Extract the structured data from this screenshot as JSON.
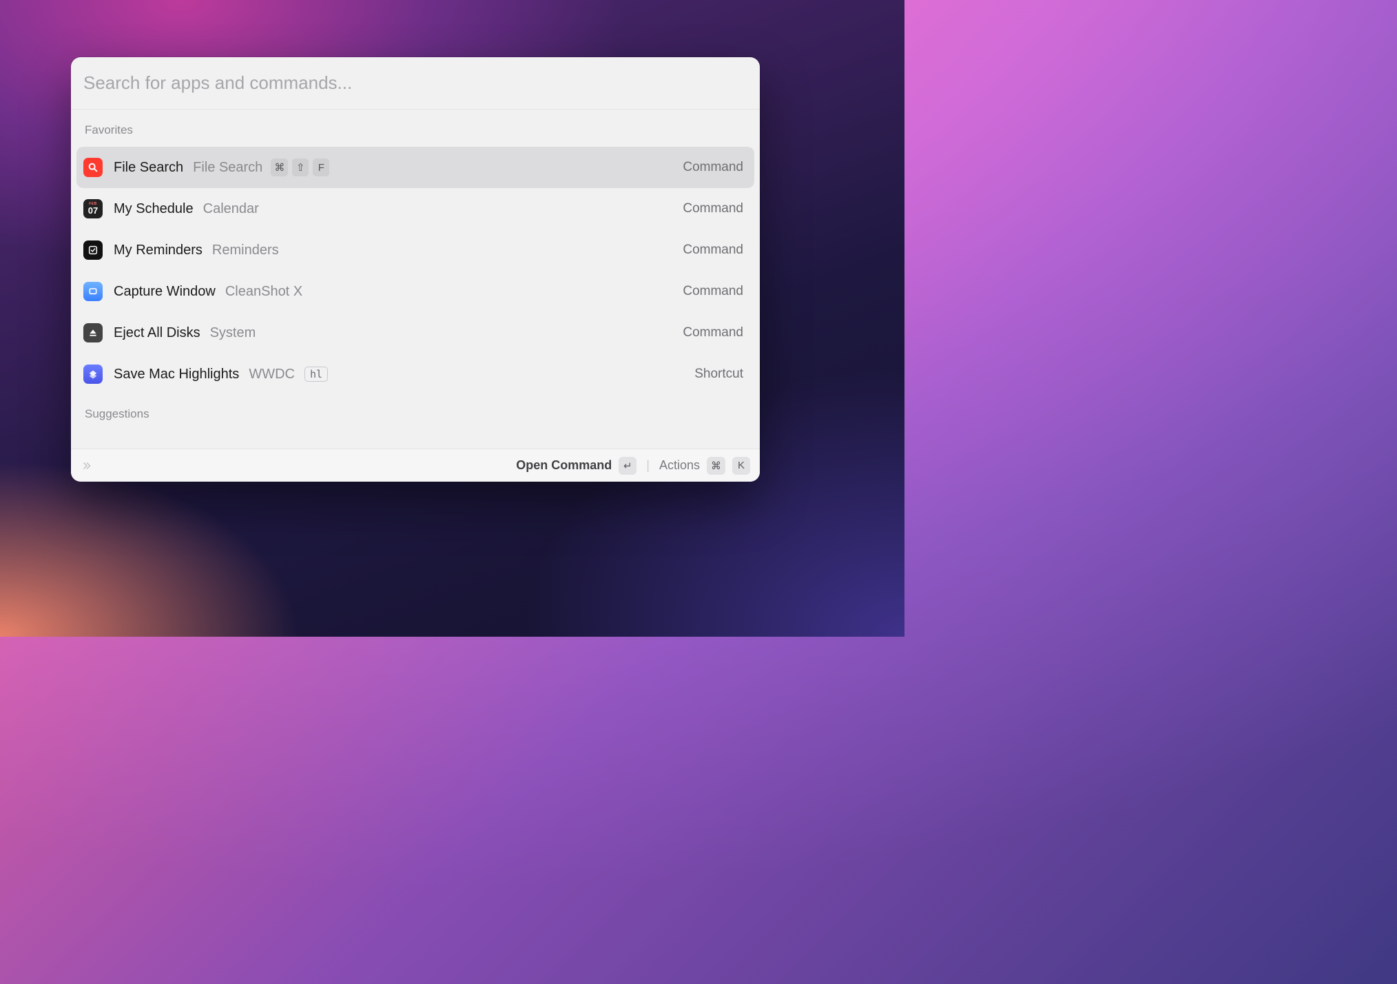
{
  "search": {
    "placeholder": "Search for apps and commands...",
    "value": ""
  },
  "sections": {
    "favorites_label": "Favorites",
    "suggestions_label": "Suggestions"
  },
  "items": [
    {
      "title": "File Search",
      "subtitle": "File Search",
      "type": "Command",
      "icon": "search",
      "selected": true,
      "shortcut": [
        "⌘",
        "⇧",
        "F"
      ]
    },
    {
      "title": "My Schedule",
      "subtitle": "Calendar",
      "type": "Command",
      "icon": "calendar",
      "calendar_month": "FEB",
      "calendar_day": "07"
    },
    {
      "title": "My Reminders",
      "subtitle": "Reminders",
      "type": "Command",
      "icon": "reminders"
    },
    {
      "title": "Capture Window",
      "subtitle": "CleanShot X",
      "type": "Command",
      "icon": "capture"
    },
    {
      "title": "Eject All Disks",
      "subtitle": "System",
      "type": "Command",
      "icon": "eject"
    },
    {
      "title": "Save Mac Highlights",
      "subtitle": "WWDC",
      "type": "Shortcut",
      "icon": "shortcut",
      "badge": "hl"
    }
  ],
  "footer": {
    "open_label": "Open Command",
    "open_key": "↵",
    "actions_label": "Actions",
    "actions_keys": [
      "⌘",
      "K"
    ]
  }
}
